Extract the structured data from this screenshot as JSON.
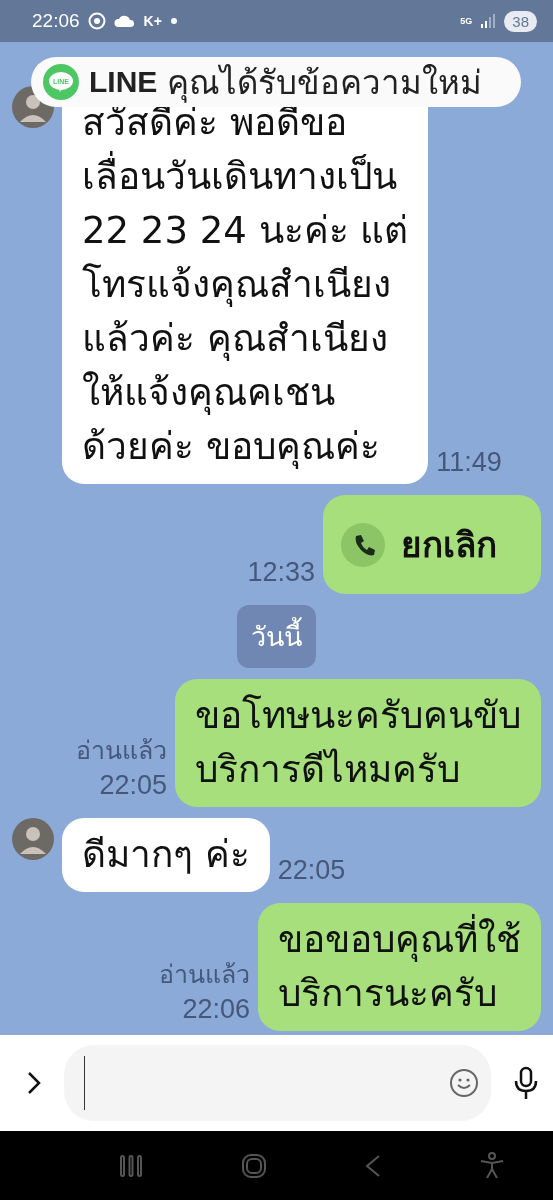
{
  "status_bar": {
    "time": "22:06",
    "carrier_badge": "K+",
    "network": "5G",
    "battery": "38"
  },
  "notification": {
    "app_icon_label": "LINE",
    "app": "LINE",
    "message": "คุณได้รับข้อความใหม่"
  },
  "messages": [
    {
      "kind": "incoming",
      "text": "สวัสดีค่ะ พอดีขอ\nเลื่อนวันเดินทางเป็น\n22 23 24 นะค่ะ แต่\nโทรแจ้งคุณสำเนียง\nแล้วค่ะ คุณสำเนียง\nให้แจ้งคุณคเชน\nด้วยค่ะ ขอบคุณค่ะ",
      "time": "11:49"
    },
    {
      "kind": "call",
      "text": "ยกเลิก",
      "time": "12:33"
    },
    {
      "kind": "date",
      "text": "วันนี้"
    },
    {
      "kind": "outgoing",
      "text": "ขอโทษนะครับคนขับ\nบริการดีไหมครับ",
      "read": "อ่านแล้ว",
      "time": "22:05"
    },
    {
      "kind": "incoming",
      "text": "ดีมากๆ ค่ะ",
      "time": "22:05"
    },
    {
      "kind": "outgoing",
      "text": "ขอขอบคุณที่ใช้\nบริการนะครับ",
      "read": "อ่านแล้ว",
      "time": "22:06"
    }
  ]
}
